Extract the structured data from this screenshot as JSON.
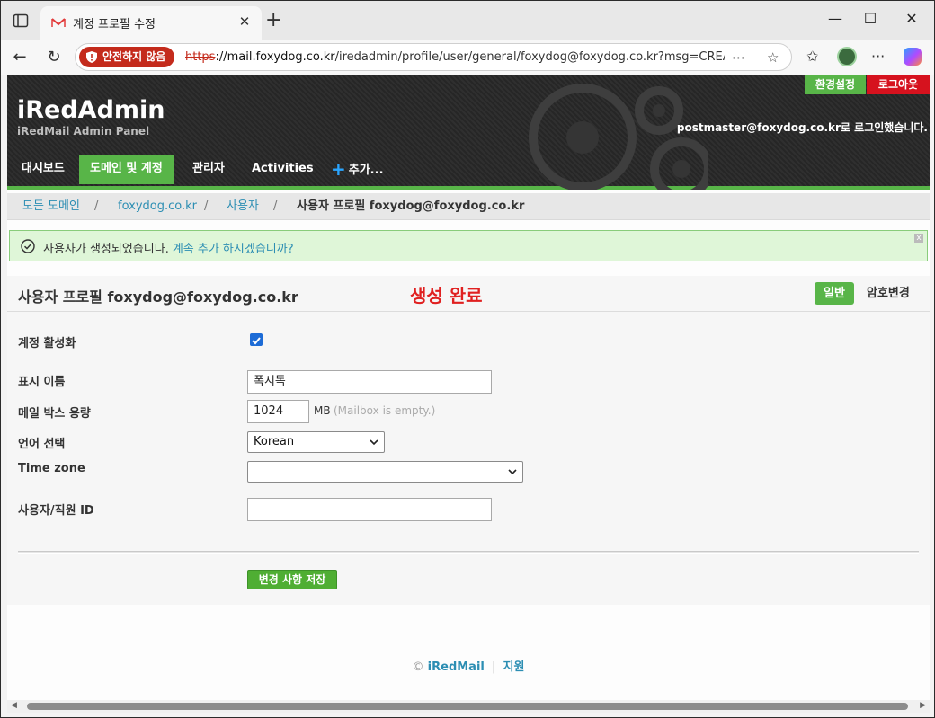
{
  "browser": {
    "tab_title": "계정 프로필 수정",
    "security_badge": "안전하지 않음",
    "url_protocol": "https",
    "url_host": "://mail.foxydog.co.kr",
    "url_path": "/iredadmin/profile/user/general/foxydog@foxydog.co.kr?msg=CREA..."
  },
  "header": {
    "brand": "iRedAdmin",
    "brand_sub": "iRedMail Admin Panel",
    "preferences_label": "환경설정",
    "logout_label": "로그아웃",
    "login_info": "postmaster@foxydog.co.kr로 로그인했습니다.",
    "nav": [
      {
        "label": "대시보드"
      },
      {
        "label": "도메인 및 계정"
      },
      {
        "label": "관리자"
      },
      {
        "label": "Activities"
      },
      {
        "label": "추가..."
      }
    ]
  },
  "breadcrumb": {
    "items": [
      "모든 도메인",
      "foxydog.co.kr",
      "사용자"
    ],
    "separator": "/",
    "current": "사용자 프로필 foxydog@foxydog.co.kr"
  },
  "notice": {
    "message": "사용자가 생성되었습니다.",
    "link": "계속 추가 하시겠습니까?",
    "close": "x"
  },
  "profile": {
    "title": "사용자 프로필 foxydog@foxydog.co.kr",
    "created_banner": "생성 완료",
    "tabs": [
      "일반",
      "암호변경"
    ],
    "fields": {
      "enable_label": "계정 활성화",
      "enable_checked": true,
      "display_name_label": "표시 이름",
      "display_name_value": "폭시독",
      "quota_label": "메일 박스 용량",
      "quota_value": "1024",
      "quota_unit": "MB",
      "quota_hint": "(Mailbox is empty.)",
      "language_label": "언어 선택",
      "language_value": "Korean",
      "timezone_label": "Time zone",
      "timezone_value": "",
      "employee_id_label": "사용자/직원 ID",
      "employee_id_value": ""
    },
    "save_label": "변경 사항 저장"
  },
  "footer": {
    "copyright": "©",
    "brand_link": "iRedMail",
    "separator": "|",
    "support_link": "지원"
  },
  "colors": {
    "accent_green": "#58b548",
    "danger_red": "#e02020",
    "link_blue": "#2c8eb3"
  }
}
